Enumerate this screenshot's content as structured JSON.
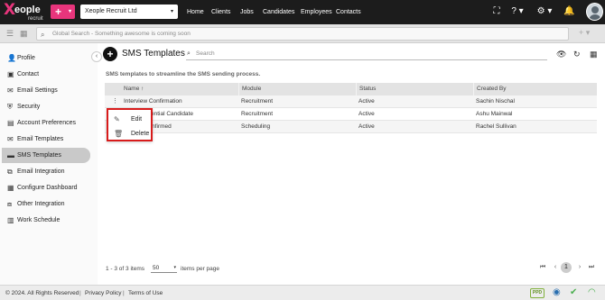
{
  "brand": {
    "logo_text": "eople",
    "logo_x": "X",
    "logo_sub": "recruit",
    "accent": "#e8357c"
  },
  "topbar": {
    "add_label": "+",
    "org_select": "Xeople Recruit Ltd",
    "nav": [
      "Home",
      "Clients",
      "Jobs",
      "Candidates",
      "Employees",
      "Contacts"
    ],
    "icons": [
      "fullscreen-icon",
      "help-icon",
      "settings-icon",
      "bell-icon",
      "avatar"
    ]
  },
  "search": {
    "placeholder": "Global Search - Something awesome is coming soon"
  },
  "sidebar": {
    "items": [
      {
        "label": "Profile",
        "icon": "person-icon"
      },
      {
        "label": "Contact",
        "icon": "contact-card-icon"
      },
      {
        "label": "Email Settings",
        "icon": "envelope-icon"
      },
      {
        "label": "Security",
        "icon": "shield-icon"
      },
      {
        "label": "Account Preferences",
        "icon": "account-preferences-icon"
      },
      {
        "label": "Email Templates",
        "icon": "email-template-icon"
      },
      {
        "label": "SMS Templates",
        "icon": "sms-icon",
        "active": true
      },
      {
        "label": "Email Integration",
        "icon": "integration-icon"
      },
      {
        "label": "Configure Dashboard",
        "icon": "dashboard-icon"
      },
      {
        "label": "Other Integration",
        "icon": "plug-icon"
      },
      {
        "label": "Work Schedule",
        "icon": "calendar-icon"
      }
    ]
  },
  "main": {
    "title": "SMS Templates",
    "search_placeholder": "Search",
    "subtitle": "SMS templates to streamline the SMS sending process.",
    "columns": [
      "Name",
      "Module",
      "Status",
      "Created By"
    ],
    "rows": [
      {
        "name": "Interview Confirmation",
        "module": "Recruitment",
        "status": "Active",
        "created_by": "Sachin Nischal"
      },
      {
        "name": "ate for Potential Candidate",
        "module": "Recruitment",
        "status": "Active",
        "created_by": "Ashu Mainwal"
      },
      {
        "name": "ew time confirmed",
        "module": "Scheduling",
        "status": "Active",
        "created_by": "Rachel Sullivan"
      }
    ],
    "context_menu": {
      "edit": "Edit",
      "delete": "Delete"
    }
  },
  "pagination": {
    "range_text": "1 - 3 of 3 items",
    "per_page": "50",
    "per_page_label": "items per page",
    "current_page": "1"
  },
  "footer": {
    "copyright": "© 2024. All Rights Reserved",
    "privacy": "Privacy Policy",
    "terms": "Terms of Use",
    "badge": "PPD"
  }
}
